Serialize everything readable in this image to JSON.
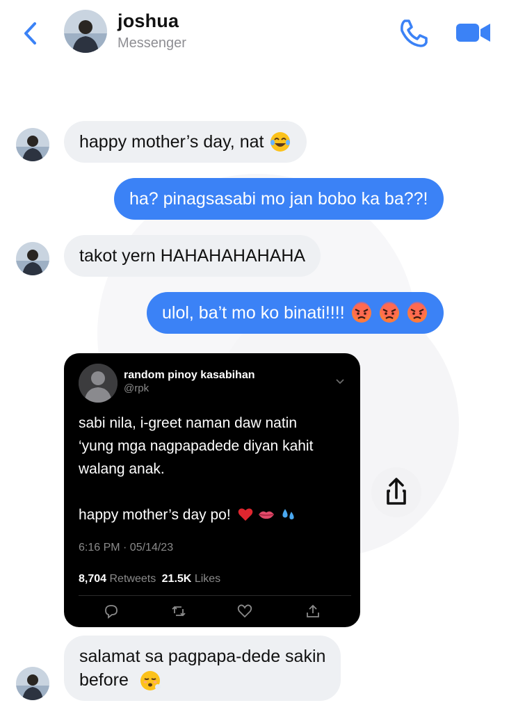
{
  "header": {
    "name": "joshua",
    "subtitle": "Messenger",
    "accent": "#3b82f6"
  },
  "messages": [
    {
      "from": "joshua",
      "text": "happy mother’s day, nat",
      "emoji": "face-with-tears-of-joy"
    },
    {
      "from": "me",
      "text": "ha? pinagsasabi mo jan bobo ka ba??!"
    },
    {
      "from": "joshua",
      "text": "takot yern HAHAHAHAHAHA"
    },
    {
      "from": "me",
      "text": "ulol, ba’t mo ko binati!!!!",
      "emoji": "angry-face x3"
    },
    {
      "from": "joshua",
      "type": "shared-tweet"
    },
    {
      "from": "joshua",
      "line1": "salamat sa pagpapa-dede sakin",
      "line2": "before",
      "emoji": "face-exhaling"
    }
  ],
  "tweet": {
    "name": "random pinoy kasabihan",
    "handle": "@rpk",
    "line1": "sabi nila, i-greet naman daw natin",
    "line2": "‘yung mga nagpapadede diyan kahit",
    "line3": "walang anak.",
    "line4": "happy mother’s day po!",
    "emojis": [
      "red-heart",
      "lips",
      "sweat-droplets"
    ],
    "time": "6:16 PM · 05/14/23",
    "retweets": "8,704",
    "retweets_label": "Retweets",
    "likes": "21.5K",
    "likes_label": "Likes"
  },
  "colors": {
    "incoming_bubble": "#eef0f3",
    "outgoing_bubble": "#3b82f6",
    "tweet_bg": "#000000"
  }
}
